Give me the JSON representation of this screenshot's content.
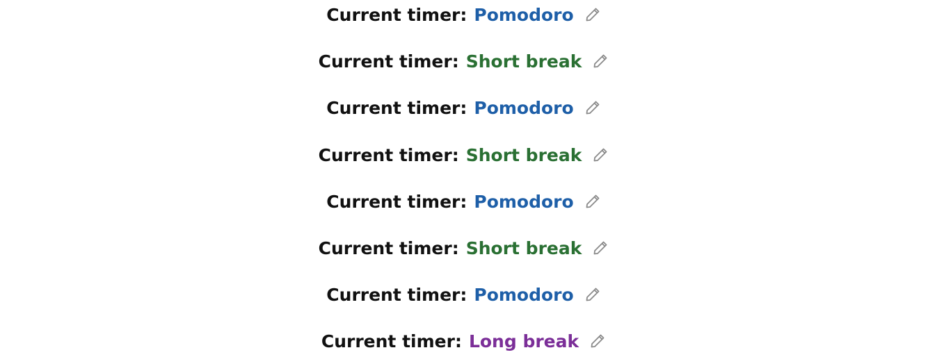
{
  "timers": [
    {
      "label": "Current timer",
      "value": "Pomodoro",
      "color": "#1e5fa8",
      "icon": "pencil-icon"
    },
    {
      "label": "Current timer",
      "value": "Short break",
      "color": "#2a7033",
      "icon": "pencil-icon"
    },
    {
      "label": "Current timer",
      "value": "Pomodoro",
      "color": "#1e5fa8",
      "icon": "pencil-icon"
    },
    {
      "label": "Current timer",
      "value": "Short break",
      "color": "#2a7033",
      "icon": "pencil-icon"
    },
    {
      "label": "Current timer",
      "value": "Pomodoro",
      "color": "#1e5fa8",
      "icon": "pencil-icon"
    },
    {
      "label": "Current timer",
      "value": "Short break",
      "color": "#2a7033",
      "icon": "pencil-icon"
    },
    {
      "label": "Current timer",
      "value": "Pomodoro",
      "color": "#1e5fa8",
      "icon": "pencil-icon"
    },
    {
      "label": "Current timer",
      "value": "Long break",
      "color": "#7b2e98",
      "icon": "pencil-icon"
    }
  ],
  "separator": ":",
  "colors": {
    "label": "#111111",
    "icon": "#8a8a8a"
  }
}
